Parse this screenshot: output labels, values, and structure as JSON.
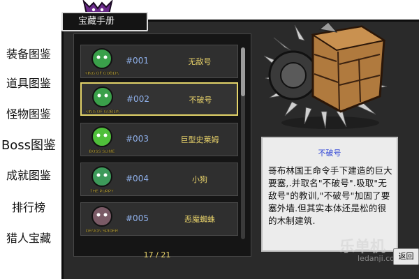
{
  "title": "宝藏手册",
  "sidebar": {
    "items": [
      {
        "label": "装备图鉴"
      },
      {
        "label": "道具图鉴"
      },
      {
        "label": "怪物图鉴"
      },
      {
        "label": "Boss图鉴"
      },
      {
        "label": "成就图鉴"
      },
      {
        "label": "排行榜"
      },
      {
        "label": "猎人宝藏"
      }
    ]
  },
  "list": {
    "items": [
      {
        "number": "#001",
        "name": "无敌号",
        "badge": "KING OF GOBLIN",
        "color": "#3aa04a"
      },
      {
        "number": "#002",
        "name": "不破号",
        "badge": "KING OF GOBLIN",
        "color": "#3aa04a"
      },
      {
        "number": "#003",
        "name": "巨型史莱姆",
        "badge": "BOSS SLIME",
        "color": "#4fbf3a"
      },
      {
        "number": "#004",
        "name": "小狗",
        "badge": "THE PUPPY",
        "color": "#3d9a5a"
      },
      {
        "number": "#005",
        "name": "恶魔蜘蛛",
        "badge": "DEMON SPIDER",
        "color": "#7a5a66"
      }
    ],
    "selected_index": 1,
    "page": "17 / 21"
  },
  "detail": {
    "title": "不破号",
    "description": "哥布林国王命令手下建造的巨大要塞,.并取名\"不破号\".吸取\"无敌号\"的教训,\"不破号\"加固了要塞外墙.但其实本体还是松的很的木制建筑."
  },
  "back_label": "返回",
  "watermark": {
    "main": "乐单机",
    "sub": "ledanji.com"
  }
}
